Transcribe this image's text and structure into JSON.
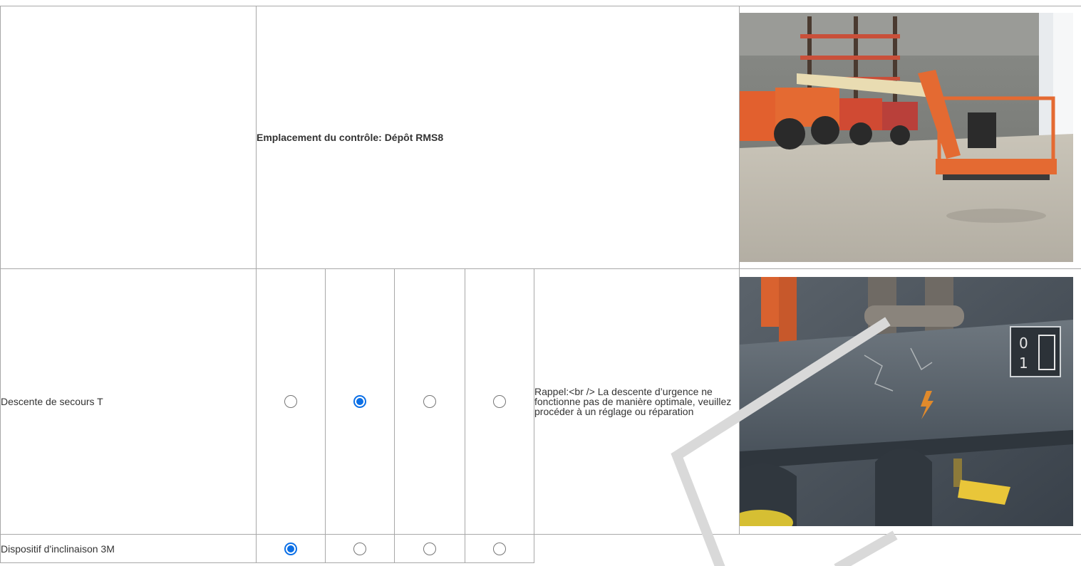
{
  "location": {
    "label": "Emplacement du contrôle: Dépôt RMS8"
  },
  "rows": [
    {
      "label": "Descente de secours T",
      "options_checked": [
        false,
        true,
        false,
        false
      ],
      "comment": "Rappel:<br /> La descente d’urgence ne fonctionne pas de manière optimale, veuillez procéder à un réglage ou réparation"
    },
    {
      "label": "Dispositif d'inclinaison 3M",
      "options_checked": [
        true,
        false,
        false,
        false
      ],
      "comment": ""
    }
  ],
  "photos": [
    {
      "icon": "aerial-work-platform-warehouse-photo"
    },
    {
      "icon": "emergency-lowering-control-closeup-photo"
    }
  ],
  "colors": {
    "radio_checked": "#0b6fe6",
    "border": "#a8a8a8",
    "text": "#333333"
  }
}
